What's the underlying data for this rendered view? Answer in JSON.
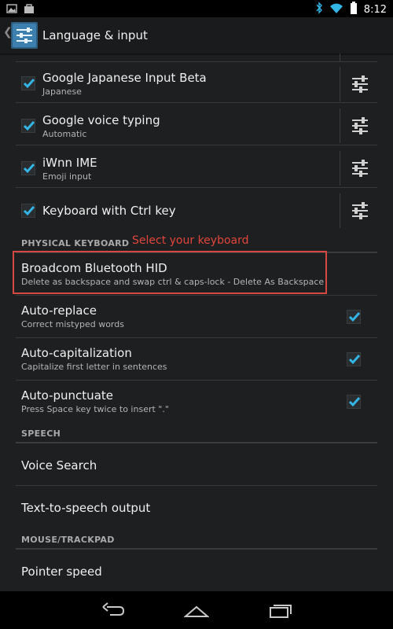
{
  "status_bar": {
    "time": "8:12"
  },
  "action_bar": {
    "title": "Language & input"
  },
  "input_methods": [
    {
      "title": "Google Japanese Input Beta",
      "summary": "Japanese",
      "checked": true
    },
    {
      "title": "Google voice typing",
      "summary": "Automatic",
      "checked": true
    },
    {
      "title": "iWnn IME",
      "summary": "Emoji input",
      "checked": true
    },
    {
      "title": "Keyboard with Ctrl key",
      "summary": "",
      "checked": true
    }
  ],
  "physical_keyboard": {
    "header": "PHYSICAL KEYBOARD",
    "annotation": "Select your keyboard",
    "device": {
      "title": "Broadcom Bluetooth HID",
      "summary": "Delete as backspace and swap ctrl & caps-lock - Delete As Backspace"
    },
    "options": [
      {
        "title": "Auto-replace",
        "summary": "Correct mistyped words",
        "checked": true
      },
      {
        "title": "Auto-capitalization",
        "summary": "Capitalize first letter in sentences",
        "checked": true
      },
      {
        "title": "Auto-punctuate",
        "summary": "Press Space key twice to insert \".\"",
        "checked": true
      }
    ]
  },
  "speech": {
    "header": "SPEECH",
    "items": [
      "Voice Search",
      "Text-to-speech output"
    ]
  },
  "mouse": {
    "header": "MOUSE/TRACKPAD",
    "items": [
      "Pointer speed"
    ]
  },
  "colors": {
    "accent": "#33b5e5",
    "annotation": "#e2453c"
  }
}
